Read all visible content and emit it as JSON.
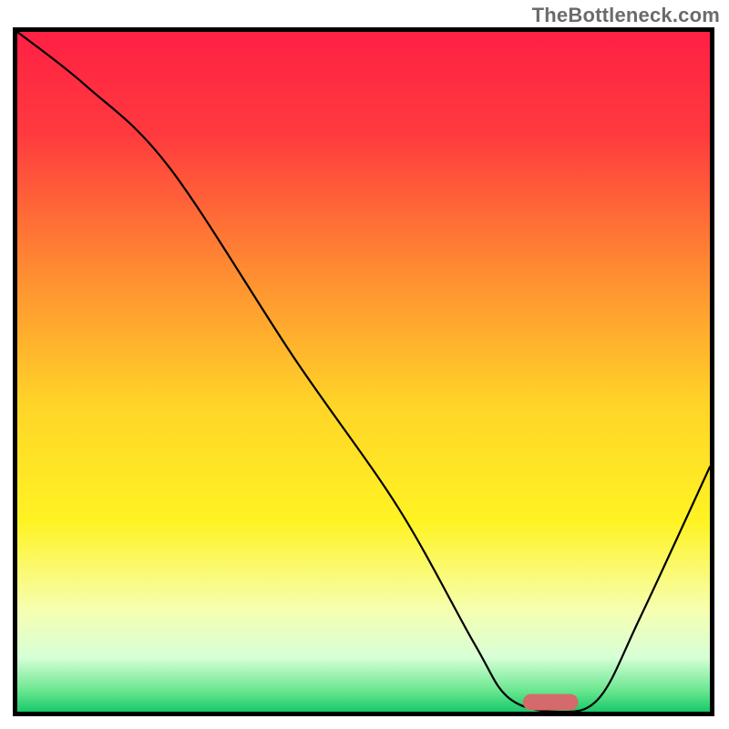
{
  "watermark": "TheBottleneck.com",
  "chart_data": {
    "type": "line",
    "title": "",
    "xlabel": "",
    "ylabel": "",
    "xlim": [
      0,
      100
    ],
    "ylim": [
      0,
      100
    ],
    "grid": false,
    "legend": false,
    "background_gradient": {
      "stops": [
        {
          "offset": 0.0,
          "color": "#ff2044"
        },
        {
          "offset": 0.15,
          "color": "#ff3a3e"
        },
        {
          "offset": 0.35,
          "color": "#ff8b32"
        },
        {
          "offset": 0.55,
          "color": "#ffd528"
        },
        {
          "offset": 0.72,
          "color": "#fff323"
        },
        {
          "offset": 0.85,
          "color": "#f6ffb0"
        },
        {
          "offset": 0.92,
          "color": "#d7ffd7"
        },
        {
          "offset": 0.97,
          "color": "#67e68e"
        },
        {
          "offset": 1.0,
          "color": "#18c96a"
        }
      ]
    },
    "series": [
      {
        "name": "bottleneck-curve",
        "x": [
          0,
          10,
          22,
          40,
          55,
          66,
          71,
          78,
          84,
          90,
          100
        ],
        "y": [
          100,
          92,
          80,
          52,
          30,
          10,
          2,
          0,
          2,
          14,
          36
        ]
      }
    ],
    "marker": {
      "name": "optimal-range",
      "shape": "pill",
      "color": "#d46a6a",
      "x_center": 77,
      "y_center": 1.4,
      "width": 8,
      "height": 2.4
    }
  }
}
